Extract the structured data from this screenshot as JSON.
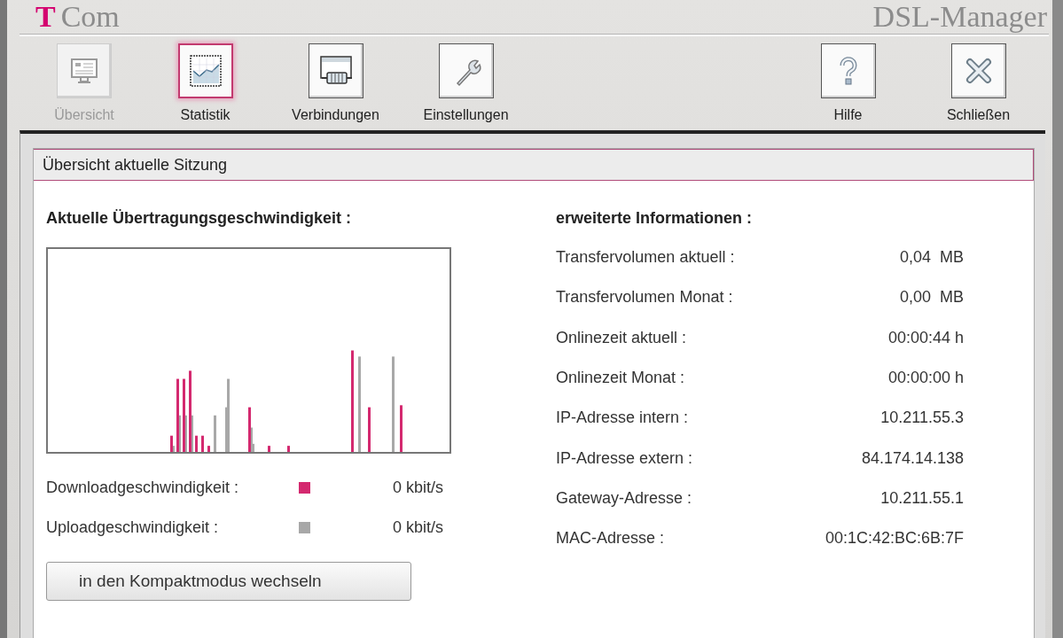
{
  "header": {
    "logo_mark": "T",
    "logo_text": "Com",
    "title": "DSL-Manager"
  },
  "toolbar": {
    "left": [
      {
        "kind": "overview",
        "label": "Übersicht",
        "disabled": true,
        "selected": false
      },
      {
        "kind": "statistics",
        "label": "Statistik",
        "disabled": false,
        "selected": true
      },
      {
        "kind": "connections",
        "label": "Verbindungen",
        "disabled": false,
        "selected": false
      },
      {
        "kind": "settings",
        "label": "Einstellungen",
        "disabled": false,
        "selected": false
      }
    ],
    "right": [
      {
        "kind": "help",
        "label": "Hilfe",
        "disabled": false,
        "selected": false
      },
      {
        "kind": "close",
        "label": "Schließen",
        "disabled": false,
        "selected": false
      }
    ]
  },
  "section": {
    "title": "Übersicht aktuelle Sitzung",
    "speed": {
      "heading": "Aktuelle Übertragungsgeschwindigkeit :",
      "legend": [
        {
          "label": "Downloadgeschwindigkeit :",
          "color": "#d4296f",
          "value": "0 kbit/s"
        },
        {
          "label": "Uploadgeschwindigkeit :",
          "color": "#a8a8a8",
          "value": "0 kbit/s"
        }
      ]
    },
    "info": {
      "heading": "erweiterte Informationen :",
      "rows": [
        {
          "label": "Transfervolumen aktuell :",
          "value": "0,04  MB"
        },
        {
          "label": "Transfervolumen Monat :",
          "value": "0,00  MB"
        },
        {
          "label": "Onlinezeit aktuell :",
          "value": "00:00:44 h"
        },
        {
          "label": "Onlinezeit Monat :",
          "value": "00:00:00 h"
        },
        {
          "label": "IP-Adresse intern :",
          "value": "10.211.55.3"
        },
        {
          "label": "IP-Adresse extern :",
          "value": "84.174.14.138"
        },
        {
          "label": "Gateway-Adresse :",
          "value": "10.211.55.1"
        },
        {
          "label": "MAC-Adresse :",
          "value": "00:1C:42:BC:6B:7F"
        }
      ]
    },
    "compact_button": "in den Kompaktmodus wechseln"
  }
}
